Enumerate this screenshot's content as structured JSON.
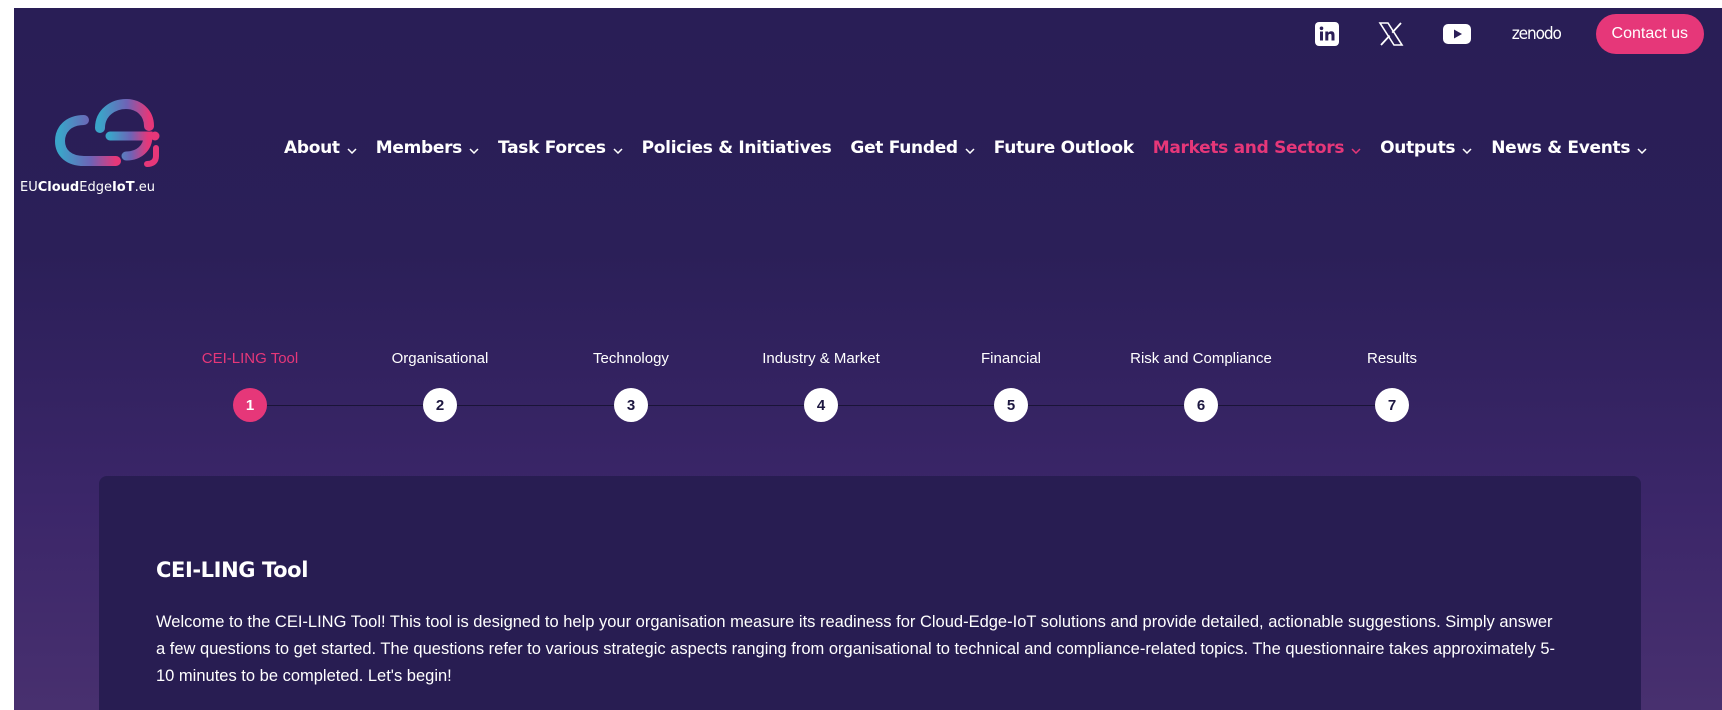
{
  "colors": {
    "background": "#2b1f58",
    "accent": "#e63779",
    "card": "#281d52",
    "text": "#ffffff"
  },
  "utility": {
    "icons": [
      "linkedin-icon",
      "x-icon",
      "youtube-icon"
    ],
    "zenodo_label": "zenodo",
    "contact_label": "Contact us"
  },
  "logo": {
    "mark": "cei",
    "text_prefix": "EU",
    "text_bold1": "Cloud",
    "text_mid": "Edge",
    "text_bold2": "IoT",
    "text_suffix": ".eu"
  },
  "nav": {
    "items": [
      {
        "label": "About",
        "dropdown": true
      },
      {
        "label": "Members",
        "dropdown": true
      },
      {
        "label": "Task Forces",
        "dropdown": true
      },
      {
        "label": "Policies & Initiatives",
        "dropdown": false
      },
      {
        "label": "Get Funded",
        "dropdown": true
      },
      {
        "label": "Future Outlook",
        "dropdown": false
      },
      {
        "label": "Markets and Sectors",
        "dropdown": true,
        "active": true
      },
      {
        "label": "Outputs",
        "dropdown": true
      },
      {
        "label": "News & Events",
        "dropdown": true
      }
    ]
  },
  "stepper": {
    "steps": [
      {
        "number": "1",
        "label": "CEI-LING Tool",
        "active": true
      },
      {
        "number": "2",
        "label": "Organisational"
      },
      {
        "number": "3",
        "label": "Technology"
      },
      {
        "number": "4",
        "label": "Industry & Market"
      },
      {
        "number": "5",
        "label": "Financial"
      },
      {
        "number": "6",
        "label": "Risk and Compliance"
      },
      {
        "number": "7",
        "label": "Results"
      }
    ]
  },
  "card": {
    "title": "CEI-LING Tool",
    "body": "Welcome to the CEI-LING Tool! This tool is designed to help your organisation measure its readiness for Cloud-Edge-IoT solutions and provide detailed, actionable suggestions. Simply answer a few questions to get started. The questions refer to various strategic aspects ranging from organisational to technical and compliance-related topics. The questionnaire takes approximately 5-10 minutes to be completed. Let's begin!"
  }
}
